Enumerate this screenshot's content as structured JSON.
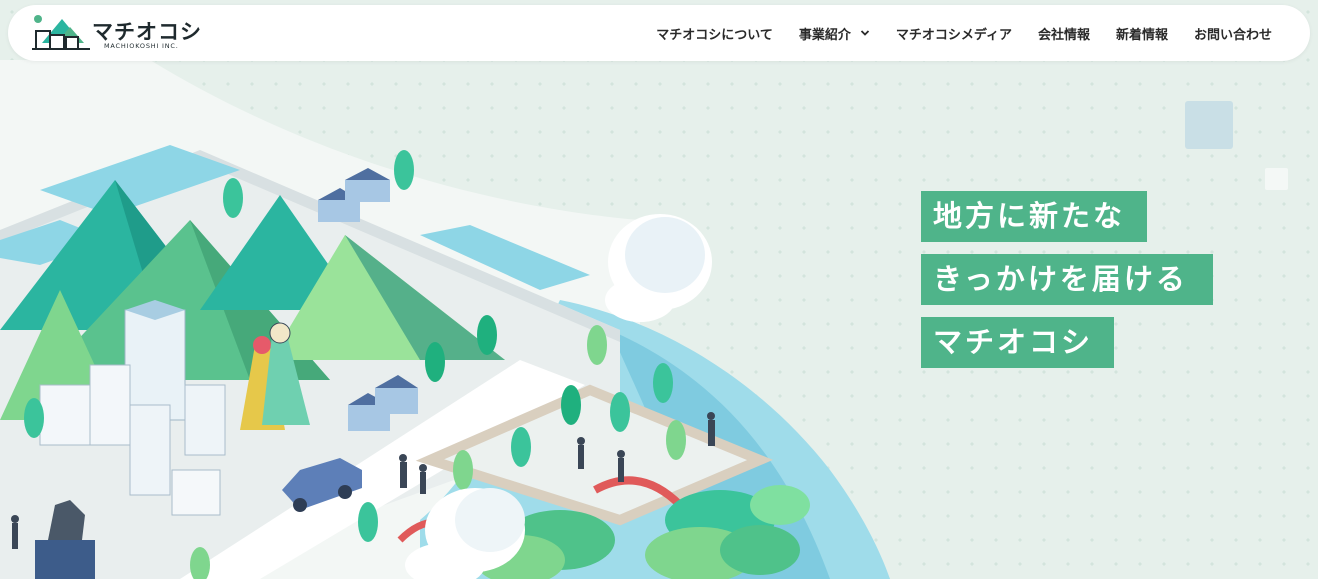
{
  "brand": {
    "name": "マチオコシ",
    "sub": "MACHIOKOSHI INC."
  },
  "nav": {
    "items": [
      {
        "label": "マチオコシについて",
        "has_dropdown": false
      },
      {
        "label": "事業紹介",
        "has_dropdown": true
      },
      {
        "label": "マチオコシメディア",
        "has_dropdown": false
      },
      {
        "label": "会社情報",
        "has_dropdown": false
      },
      {
        "label": "新着情報",
        "has_dropdown": false
      },
      {
        "label": "お問い合わせ",
        "has_dropdown": false
      }
    ]
  },
  "hero": {
    "lines": [
      "地方に新たな",
      "きっかけを届ける",
      "マチオコシ"
    ]
  },
  "colors": {
    "accent": "#4fb48a",
    "background": "#e6f0eb",
    "text": "#2a2a2a",
    "water": "#8fd3e6"
  },
  "icons": {
    "logo": "town-logo-icon",
    "dropdown": "chevron-down-icon"
  }
}
